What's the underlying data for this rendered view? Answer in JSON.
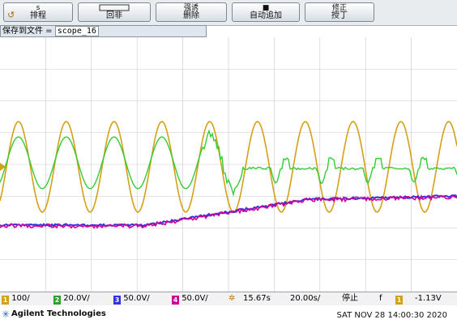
{
  "toolbar": {
    "buttons": [
      {
        "top": "s",
        "bottom": "排程",
        "icon": "undo-icon"
      },
      {
        "top": "",
        "bottom": "回非"
      },
      {
        "top": "强诱",
        "bottom": "删除"
      },
      {
        "top": "■",
        "bottom": "自动追加"
      },
      {
        "top": "修正",
        "bottom": "授丁"
      }
    ]
  },
  "save_line": {
    "label": "保存到文件 =",
    "filename": "scope_16"
  },
  "status_bar": {
    "ch1_num": "1",
    "ch1_scale": "100/",
    "ch2_num": "2",
    "ch2_scale": "20.0V/",
    "ch3_num": "3",
    "ch3_scale": "50.0V/",
    "ch4_num": "4",
    "ch4_scale": "50.0V/",
    "delay": "15.67s",
    "timebase": "20.00s/",
    "run_state": "停止",
    "trig_slope": "f",
    "trig_num": "1",
    "trig_level": "-1.13V"
  },
  "footer": {
    "brand": "Agilent Technologies",
    "timestamp": "SAT NOV 28 14:00:30 2020"
  },
  "colors": {
    "ch1": "#d4a017",
    "ch2": "#33cc33",
    "ch3": "#3333dd",
    "ch4": "#cc0099",
    "grid": "#c8c8c8"
  },
  "chart_data": {
    "type": "line",
    "series": [
      {
        "name": "1",
        "values": [
          3,
          2,
          1,
          0,
          -1,
          -2,
          -3,
          -2,
          -1,
          0,
          1,
          2,
          3
        ]
      },
      {
        "name": "2",
        "values": [
          1.5,
          1,
          0,
          -1,
          -1.5,
          0,
          0,
          0,
          0.5,
          -0.5
        ]
      },
      {
        "name": "3",
        "values": [
          -2,
          -2,
          -2,
          -1.8,
          -1.5,
          -1.2,
          -1,
          -1
        ]
      },
      {
        "name": "4",
        "values": [
          -2,
          -2,
          -2,
          -1.8,
          -1.5,
          -1.2,
          -1,
          -1
        ]
      }
    ],
    "grid": true
  }
}
